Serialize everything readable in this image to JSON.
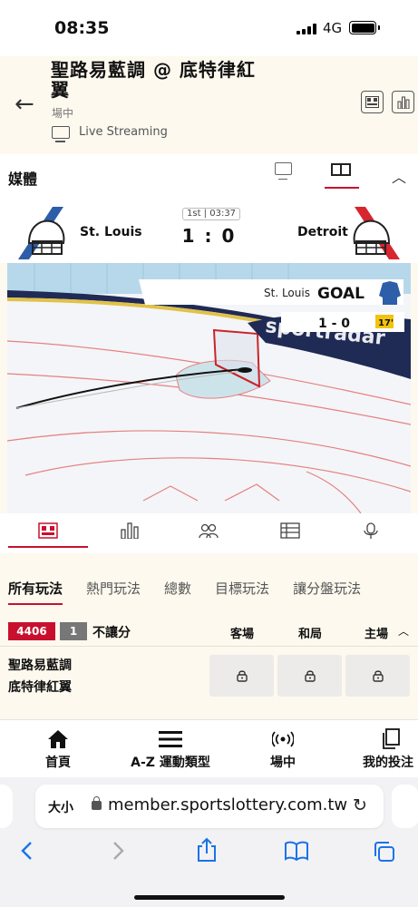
{
  "status": {
    "time": "08:35",
    "network": "4G"
  },
  "header": {
    "title": "聖路易藍調 @ 底特律紅翼",
    "subtitle": "場中",
    "live_label": "Live Streaming"
  },
  "media": {
    "label": "媒體"
  },
  "match": {
    "period": "1st | 03:37",
    "home_team": "St. Louis",
    "away_team": "Detroit",
    "score": "1 : 0"
  },
  "rink": {
    "event_team": "St. Louis",
    "event": "GOAL",
    "event_score": "1 - 0",
    "minute": "17'",
    "brand": "sportradar"
  },
  "market_tabs": [
    "所有玩法",
    "熱門玩法",
    "總數",
    "目標玩法",
    "讓分盤玩法"
  ],
  "bet": {
    "id": "4406",
    "count": "1",
    "type": "不讓分",
    "col_home": "客場",
    "col_draw": "和局",
    "col_away": "主場",
    "team1": "聖路易藍調",
    "team2": "底特律紅翼"
  },
  "nav": {
    "home": "首頁",
    "sports": "A-Z 運動類型",
    "live": "場中",
    "mybets": "我的投注"
  },
  "browser": {
    "aa": "大小",
    "url": "member.sportslottery.com.tw"
  },
  "colors": {
    "accent": "#c8102e",
    "blues": "#2d5ea8",
    "wings": "#d7262f"
  }
}
